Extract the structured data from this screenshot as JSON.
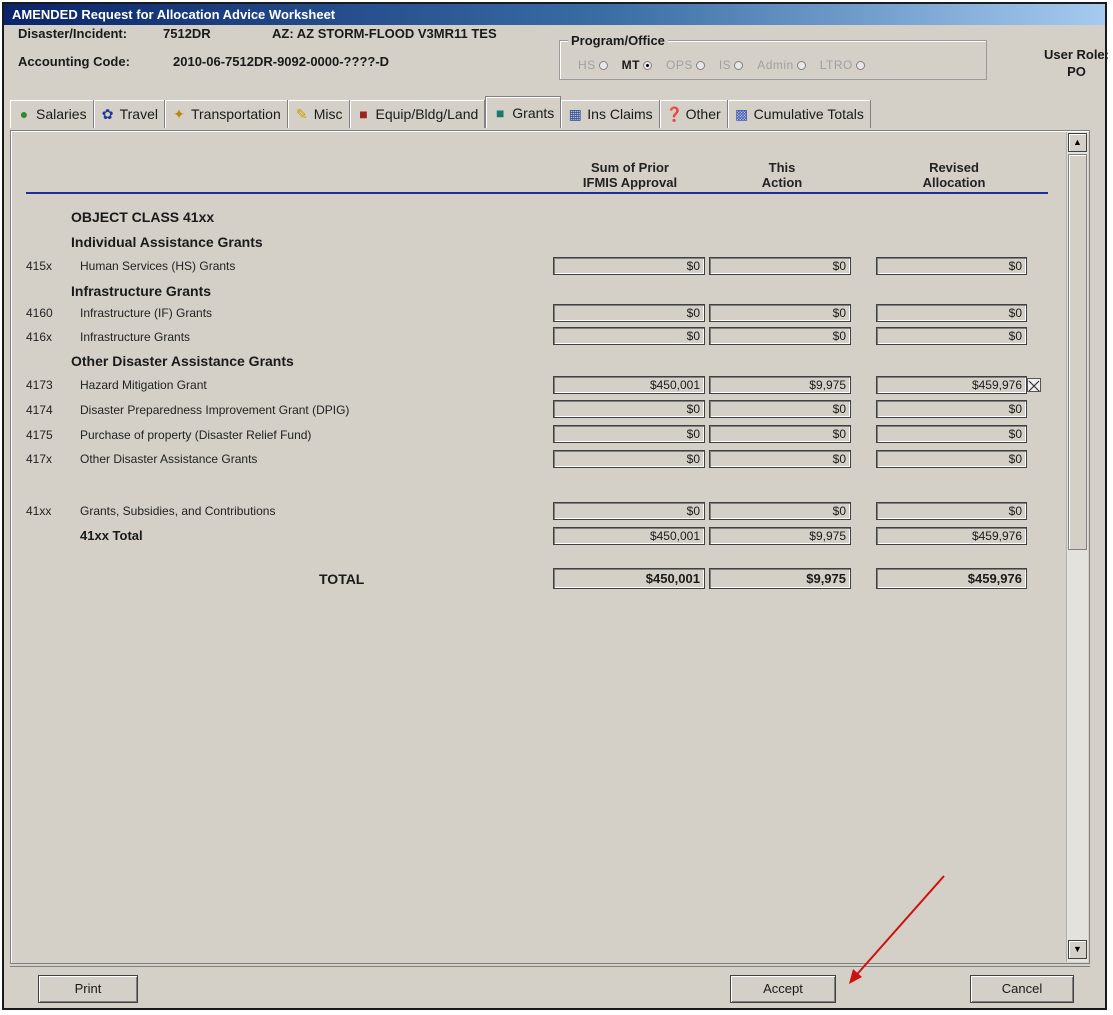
{
  "window": {
    "title": "AMENDED Request for Allocation Advice Worksheet"
  },
  "header": {
    "disaster_label": "Disaster/Incident:",
    "disaster_value": "7512DR",
    "incident_name": "AZ: AZ STORM-FLOOD V3MR11 TES",
    "accounting_label": "Accounting Code:",
    "accounting_value": "2010-06-7512DR-9092-0000-????-D",
    "program_label": "Program/Office",
    "program_options": [
      {
        "label": "HS",
        "selected": false
      },
      {
        "label": "MT",
        "selected": true
      },
      {
        "label": "OPS",
        "selected": false
      },
      {
        "label": "IS",
        "selected": false
      },
      {
        "label": "Admin",
        "selected": false
      },
      {
        "label": "LTRO",
        "selected": false
      }
    ],
    "user_role_label": "User Role:",
    "user_role_value": "PO"
  },
  "tabs": [
    {
      "label": "Salaries",
      "icon": "money-bag-icon"
    },
    {
      "label": "Travel",
      "icon": "runner-icon"
    },
    {
      "label": "Transportation",
      "icon": "vehicle-icon"
    },
    {
      "label": "Misc",
      "icon": "misc-icon"
    },
    {
      "label": "Equip/Bldg/Land",
      "icon": "building-icon"
    },
    {
      "label": "Grants",
      "icon": "grants-icon",
      "active": true
    },
    {
      "label": "Ins Claims",
      "icon": "claims-icon"
    },
    {
      "label": "Other",
      "icon": "question-icon"
    },
    {
      "label": "Cumulative Totals",
      "icon": "totals-icon"
    }
  ],
  "columns": {
    "prior": [
      "Sum of Prior",
      "IFMIS Approval"
    ],
    "action": [
      "This",
      "Action"
    ],
    "revised": [
      "Revised",
      "Allocation"
    ]
  },
  "sections": {
    "object_class": "OBJECT CLASS 41xx",
    "individual": "Individual Assistance Grants",
    "infrastructure": "Infrastructure Grants",
    "other": "Other Disaster Assistance Grants"
  },
  "rows": [
    {
      "code": "415x",
      "label": "Human Services (HS) Grants",
      "prior": "$0",
      "action": "$0",
      "revised": "$0"
    },
    {
      "code": "4160",
      "label": "Infrastructure (IF) Grants",
      "prior": "$0",
      "action": "$0",
      "revised": "$0"
    },
    {
      "code": "416x",
      "label": "Infrastructure Grants",
      "prior": "$0",
      "action": "$0",
      "revised": "$0"
    },
    {
      "code": "4173",
      "label": "Hazard Mitigation Grant",
      "prior": "$450,001",
      "action": "$9,975",
      "revised": "$459,976"
    },
    {
      "code": "4174",
      "label": "Disaster Preparedness Improvement Grant (DPIG)",
      "prior": "$0",
      "action": "$0",
      "revised": "$0"
    },
    {
      "code": "4175",
      "label": "Purchase of property  (Disaster Relief Fund)",
      "prior": "$0",
      "action": "$0",
      "revised": "$0"
    },
    {
      "code": "417x",
      "label": "Other Disaster Assistance Grants",
      "prior": "$0",
      "action": "$0",
      "revised": "$0"
    },
    {
      "code": "41xx",
      "label": "Grants, Subsidies, and Contributions",
      "prior": "$0",
      "action": "$0",
      "revised": "$0"
    }
  ],
  "subtotal": {
    "label": "41xx Total",
    "prior": "$450,001",
    "action": "$9,975",
    "revised": "$459,976"
  },
  "total": {
    "label": "TOTAL",
    "prior": "$450,001",
    "action": "$9,975",
    "revised": "$459,976"
  },
  "buttons": {
    "print": "Print",
    "accept": "Accept",
    "cancel": "Cancel"
  },
  "annotation_color": "#cc1111"
}
